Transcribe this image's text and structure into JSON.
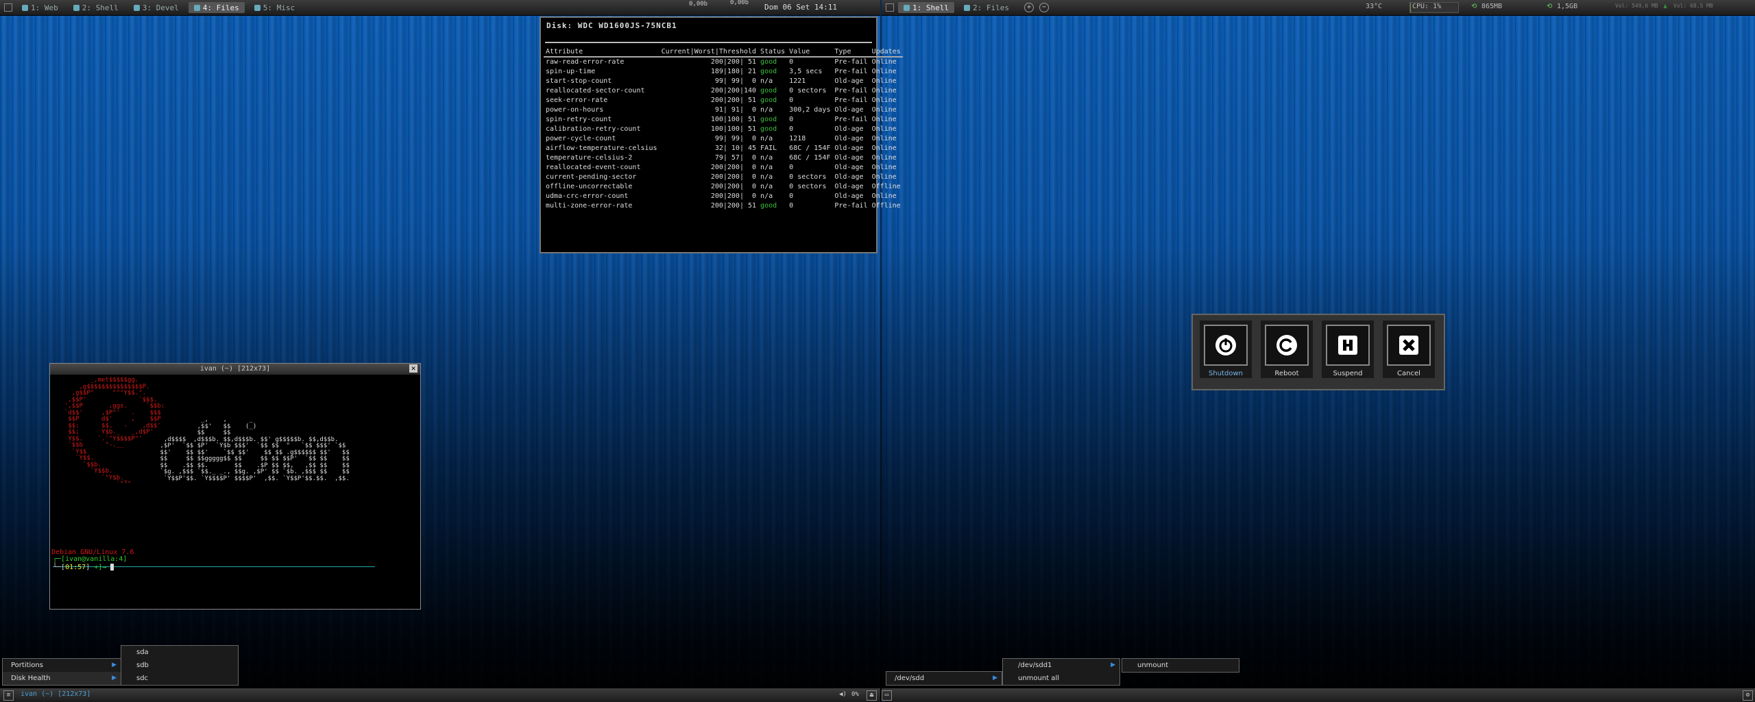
{
  "topbar_left": {
    "workspaces": [
      {
        "label": "1: Web",
        "active": false
      },
      {
        "label": "2: Shell",
        "active": false
      },
      {
        "label": "3: Devel",
        "active": false
      },
      {
        "label": "4: Files",
        "active": true
      },
      {
        "label": "5: Misc",
        "active": false
      }
    ],
    "net_down": "0,00b",
    "net_up": "0,00b",
    "clock": "Dom 06 Set  14:11"
  },
  "topbar_right": {
    "workspaces": [
      {
        "label": "1: Shell",
        "active": true
      },
      {
        "label": "2: Files",
        "active": false
      }
    ],
    "temperature": "33°C",
    "cpu": "CPU: 1%",
    "cpu_fraction": 0.01,
    "mem": "865MB",
    "disk": "1,5GB",
    "vol1": "Vol: 549,6 MB",
    "vol2": "Vol: 68,5 MB"
  },
  "disk_window": {
    "title": "Disk: WDC WD1600JS-75NCB1",
    "headers": [
      "Attribute",
      "Current|Worst|Threshold",
      "Status",
      "Value",
      "Type",
      "Updates"
    ],
    "rows": [
      [
        "raw-read-error-rate",
        "200|200| 51",
        "good",
        "0",
        "Pre-fail",
        "Online"
      ],
      [
        "spin-up-time",
        "189|180| 21",
        "good",
        "3,5 secs",
        "Pre-fail",
        "Online"
      ],
      [
        "start-stop-count",
        " 99| 99|  0",
        "n/a",
        "1221",
        "Old-age",
        "Online"
      ],
      [
        "reallocated-sector-count",
        "200|200|140",
        "good",
        "0 sectors",
        "Pre-fail",
        "Online"
      ],
      [
        "seek-error-rate",
        "200|200| 51",
        "good",
        "0",
        "Pre-fail",
        "Online"
      ],
      [
        "power-on-hours",
        " 91| 91|  0",
        "n/a",
        "300,2 days",
        "Old-age",
        "Online"
      ],
      [
        "spin-retry-count",
        "100|100| 51",
        "good",
        "0",
        "Pre-fail",
        "Online"
      ],
      [
        "calibration-retry-count",
        "100|100| 51",
        "good",
        "0",
        "Old-age",
        "Online"
      ],
      [
        "power-cycle-count",
        " 99| 99|  0",
        "n/a",
        "1218",
        "Old-age",
        "Online"
      ],
      [
        "airflow-temperature-celsius",
        " 32| 10| 45",
        "FAIL",
        "68C / 154F",
        "Old-age",
        "Online"
      ],
      [
        "temperature-celsius-2",
        " 79| 57|  0",
        "n/a",
        "68C / 154F",
        "Old-age",
        "Online"
      ],
      [
        "reallocated-event-count",
        "200|200|  0",
        "n/a",
        "0",
        "Old-age",
        "Online"
      ],
      [
        "current-pending-sector",
        "200|200|  0",
        "n/a",
        "0 sectors",
        "Old-age",
        "Online"
      ],
      [
        "offline-uncorrectable",
        "200|200|  0",
        "n/a",
        "0 sectors",
        "Old-age",
        "Offline"
      ],
      [
        "udma-crc-error-count",
        "200|200|  0",
        "n/a",
        "0",
        "Old-age",
        "Online"
      ],
      [
        "multi-zone-error-rate",
        "200|200| 51",
        "good",
        "0",
        "Pre-fail",
        "Offline"
      ]
    ]
  },
  "terminal": {
    "title": "ivan (~) [212x73]",
    "distro": "Debian GNU/Linux 7.6",
    "user_host": "ivan@vanilla:4",
    "time": "01:57"
  },
  "logout": {
    "buttons": [
      "Shutdown",
      "Reboot",
      "Suspend",
      "Cancel"
    ]
  },
  "bottombar_left": {
    "task": "ivan (~) [212x73]",
    "volume": "0%"
  },
  "menus": {
    "left_main": [
      "Portitions",
      "Disk Health"
    ],
    "left_sub": [
      "sda",
      "sdb",
      "sdc"
    ],
    "right_main": [
      "/dev/sdd"
    ],
    "right_sub": [
      "/dev/sdd1",
      "unmount all"
    ],
    "right_sub2": [
      "unmount"
    ]
  }
}
